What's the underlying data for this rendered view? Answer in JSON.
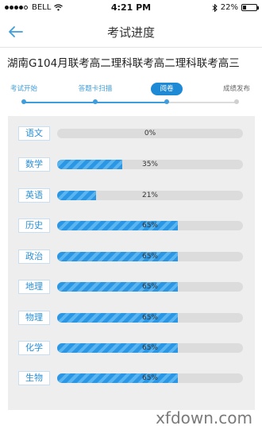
{
  "status_bar": {
    "carrier": "BELL",
    "time": "4:21 PM",
    "battery_text": "22%",
    "battery_level": 0.22
  },
  "nav": {
    "title": "考试进度"
  },
  "exam": {
    "title": "湖南G104月联考高二理科联考高二理科联考高三"
  },
  "stepper": {
    "steps": [
      {
        "label": "考试开始",
        "state": "done"
      },
      {
        "label": "答题卡扫描",
        "state": "done"
      },
      {
        "label": "阅卷",
        "state": "current"
      },
      {
        "label": "成绩发布",
        "state": "pending"
      }
    ]
  },
  "subjects": [
    {
      "name": "语文",
      "percent_text": "0%",
      "percent": 0
    },
    {
      "name": "数学",
      "percent_text": "35%",
      "percent": 35
    },
    {
      "name": "英语",
      "percent_text": "21%",
      "percent": 21
    },
    {
      "name": "历史",
      "percent_text": "65%",
      "percent": 65
    },
    {
      "name": "政治",
      "percent_text": "65%",
      "percent": 65
    },
    {
      "name": "地理",
      "percent_text": "65%",
      "percent": 65
    },
    {
      "name": "物理",
      "percent_text": "65%",
      "percent": 65
    },
    {
      "name": "化学",
      "percent_text": "65%",
      "percent": 65
    },
    {
      "name": "生物",
      "percent_text": "65%",
      "percent": 65
    }
  ],
  "watermark": "xfdown.com",
  "colors": {
    "accent": "#2b97e4",
    "accent_light": "#5ab4ef",
    "track": "#dcdcdc",
    "panel": "#eeeeee"
  }
}
